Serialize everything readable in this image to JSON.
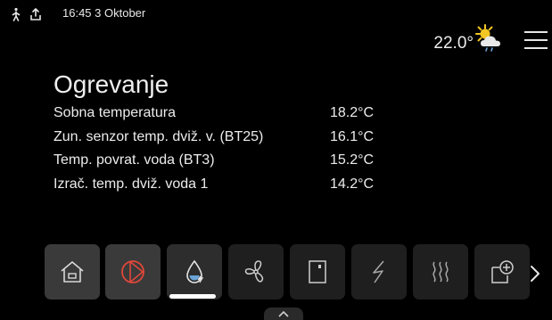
{
  "status": {
    "time_date": "16:45 3 Oktober",
    "icons": [
      "person-walking-icon",
      "upload-tray-icon"
    ]
  },
  "outdoor": {
    "temperature": "22.0°",
    "weather_icon": "sun-behind-rain-cloud-icon"
  },
  "page": {
    "title": "Ogrevanje"
  },
  "readings": [
    {
      "label": "Sobna temperatura",
      "value": "18.2°C"
    },
    {
      "label": "Zun. senzor temp. dviž. v. (BT25)",
      "value": "16.1°C"
    },
    {
      "label": "Temp. povrat. voda (BT3)",
      "value": "15.2°C"
    },
    {
      "label": "Izrač. temp. dviž. voda 1",
      "value": "14.2°C"
    }
  ],
  "tabs": [
    {
      "icon": "home-icon"
    },
    {
      "icon": "heat-pump-icon"
    },
    {
      "icon": "heating-water-drop-icon",
      "selected": true
    },
    {
      "icon": "ventilation-fan-icon"
    },
    {
      "icon": "water-heater-tank-icon"
    },
    {
      "icon": "electric-lightning-icon"
    },
    {
      "icon": "heat-waves-icon"
    },
    {
      "icon": "add-module-icon"
    }
  ],
  "colors": {
    "background": "#000000",
    "tile": "#1f1f1f",
    "tile_highlight": "#3a3a3a",
    "heat_pump_red": "#e0473a",
    "water_drop_blue": "#6aa4d8",
    "text": "#ececec",
    "sun_yellow": "#f3c623"
  }
}
